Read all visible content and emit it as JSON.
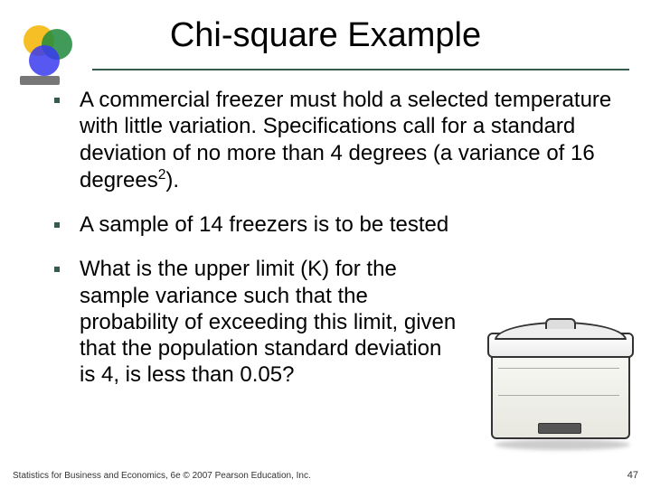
{
  "title": "Chi-square Example",
  "bullets": {
    "b1_before": "A commercial freezer must hold a selected temperature with little variation. Specifications call for a standard deviation of no more than 4 degrees (a variance of 16 degrees",
    "b1_sup": "2",
    "b1_after": ").",
    "b2": "A sample of 14 freezers is to be tested",
    "b3": "What is the upper limit (K) for the sample variance such that the probability of exceeding this limit, given that the population standard deviation is 4, is less than 0.05?"
  },
  "footer": "Statistics for Business and Economics, 6e © 2007 Pearson Education, Inc.",
  "page_number": "47"
}
